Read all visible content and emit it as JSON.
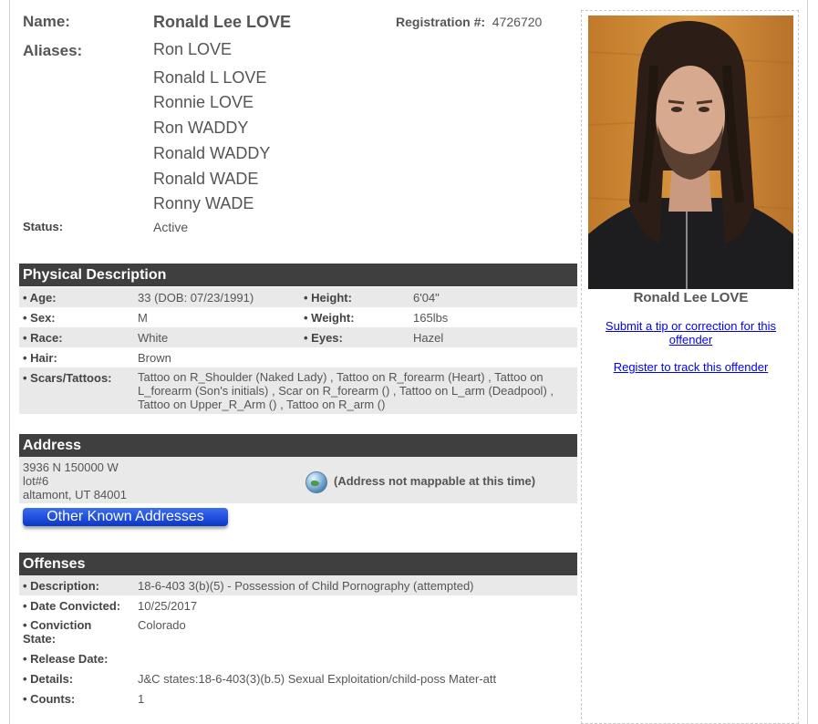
{
  "profile": {
    "name_label": "Name:",
    "name": "Ronald Lee LOVE",
    "registration_label": "Registration #:",
    "registration_number": "4726720",
    "aliases_label": "Aliases:",
    "aliases": [
      "Ron LOVE",
      "Ronald L LOVE",
      "Ronnie LOVE",
      "Ron WADDY",
      "Ronald WADDY",
      "Ronald WADE",
      "Ronny WADE"
    ],
    "status_label": "Status:",
    "status": "Active"
  },
  "physical": {
    "title": "Physical Description",
    "age_label": "• Age:",
    "age": "33  (DOB: 07/23/1991)",
    "height_label": "• Height:",
    "height": "6'04\"",
    "sex_label": "• Sex:",
    "sex": "M",
    "weight_label": "• Weight:",
    "weight": "165lbs",
    "race_label": "• Race:",
    "race": "White",
    "eyes_label": "• Eyes:",
    "eyes": "Hazel",
    "hair_label": "• Hair:",
    "hair": "Brown",
    "scars_label": "• Scars/Tattoos:",
    "scars_lines": [
      "Tattoo on R_Shoulder (Naked Lady) , Tattoo on R_forearm (Heart) , Tattoo on",
      "L_forearm (Son's initials) , Scar on R_forearm () , Tattoo on L_arm (Deadpool) ,",
      "Tattoo on Upper_R_Arm () , Tattoo on R_arm ()"
    ]
  },
  "address": {
    "title": "Address",
    "lines": [
      "3936 N 150000 W",
      "lot#6",
      "altamont, UT 84001"
    ],
    "map_status": "(Address not mappable at this time)",
    "other_button": "Other Known Addresses"
  },
  "offenses": {
    "title": "Offenses",
    "description_label": "• Description:",
    "description": "18-6-403 3(b)(5) - Possession of Child Pornography (attempted)",
    "date_label": "• Date Convicted:",
    "date": "10/25/2017",
    "state_label_1": "• Conviction",
    "state_label_2": "State:",
    "state": "Colorado",
    "release_label": "• Release Date:",
    "release": "",
    "details_label": "• Details:",
    "details": "J&C states:18-6-403(3)(b.5) Sexual Exploitation/child-poss Mater-att",
    "counts_label": "• Counts:",
    "counts": "1"
  },
  "sidebar": {
    "photo_caption": "Ronald Lee LOVE",
    "tip_link_1": "Submit a tip or correction for this",
    "tip_link_2": "offender",
    "register_link": "Register to track this offender"
  },
  "colors": {
    "section_header": "#3f3f3f",
    "row_shade": "#e9e9e9",
    "link": "#0000ee",
    "button": "#0b36c8"
  }
}
